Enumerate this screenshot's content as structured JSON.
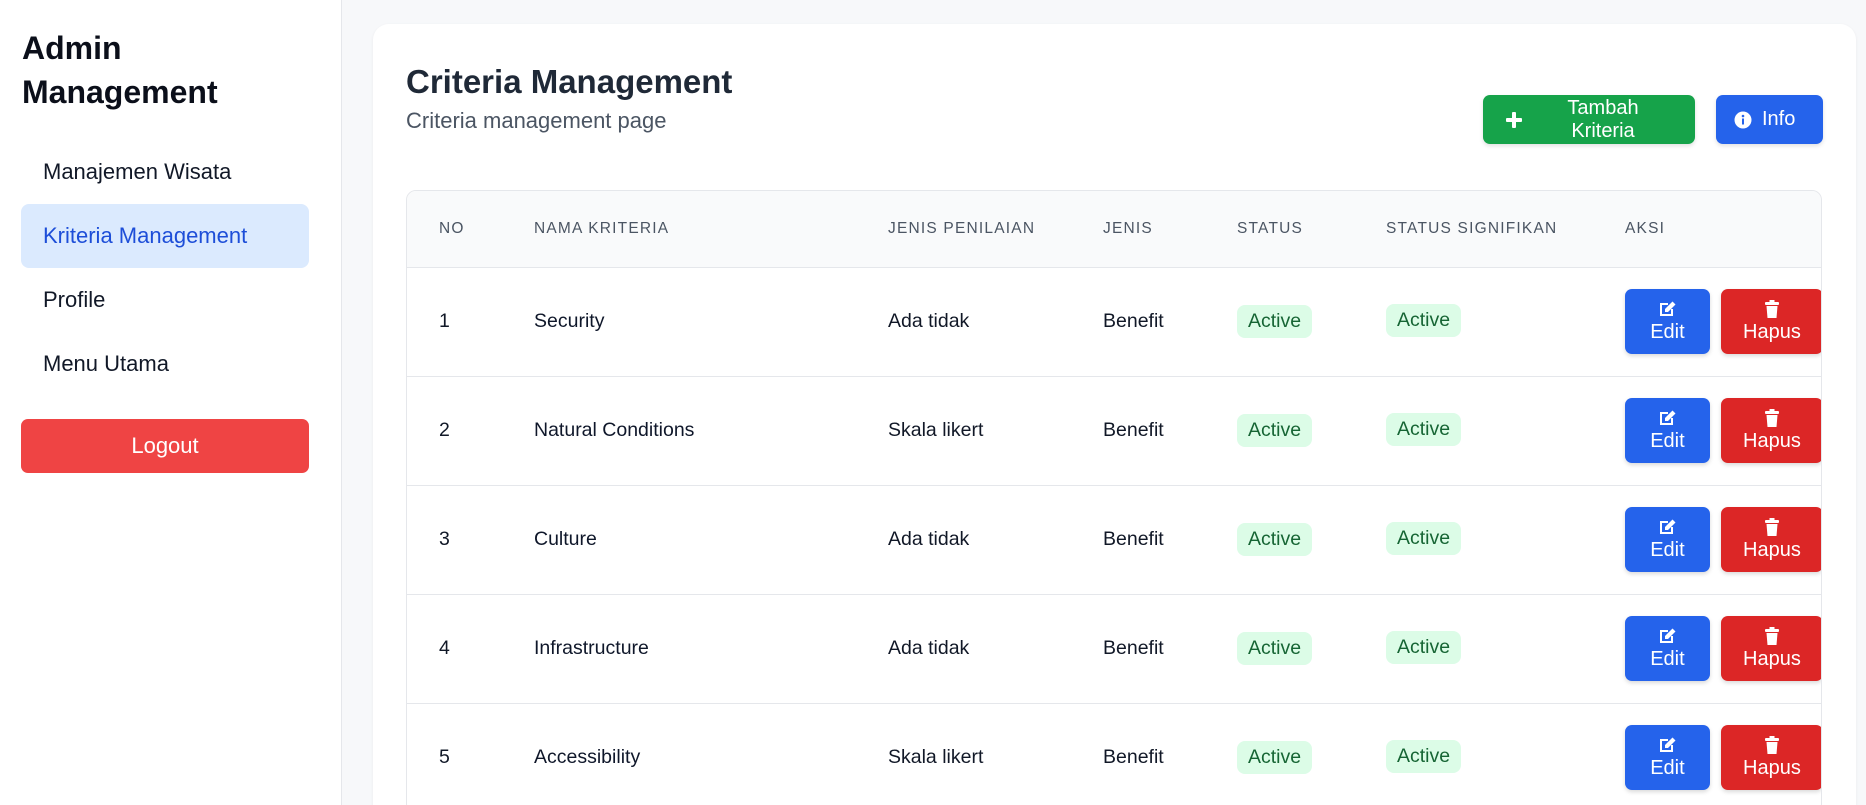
{
  "sidebar": {
    "title_line1": "Admin",
    "title_line2": "Management",
    "items": [
      {
        "label": "Manajemen Wisata"
      },
      {
        "label": "Kriteria Management"
      },
      {
        "label": "Profile"
      },
      {
        "label": "Menu Utama"
      }
    ],
    "active_item": "Kriteria Management",
    "logout_label": "Logout"
  },
  "header": {
    "title": "Criteria Management",
    "subtitle": "Criteria management page",
    "add_label": "Tambah Kriteria",
    "info_label": "Info"
  },
  "table": {
    "columns": [
      "NO",
      "NAMA KRITERIA",
      "JENIS PENILAIAN",
      "JENIS",
      "STATUS",
      "STATUS SIGNIFIKAN",
      "AKSI"
    ],
    "rows": [
      {
        "no": "1",
        "name": "Security",
        "penilaian": "Ada tidak",
        "jenis": "Benefit",
        "status": "Active",
        "signifikan": "Active"
      },
      {
        "no": "2",
        "name": "Natural Conditions",
        "penilaian": "Skala likert",
        "jenis": "Benefit",
        "status": "Active",
        "signifikan": "Active"
      },
      {
        "no": "3",
        "name": "Culture",
        "penilaian": "Ada tidak",
        "jenis": "Benefit",
        "status": "Active",
        "signifikan": "Active"
      },
      {
        "no": "4",
        "name": "Infrastructure",
        "penilaian": "Ada tidak",
        "jenis": "Benefit",
        "status": "Active",
        "signifikan": "Active"
      },
      {
        "no": "5",
        "name": "Accessibility",
        "penilaian": "Skala likert",
        "jenis": "Benefit",
        "status": "Active",
        "signifikan": "Active"
      }
    ],
    "edit_label": "Edit",
    "delete_label": "Hapus"
  },
  "icons": {
    "add": "plus-icon",
    "info": "info-circle-icon",
    "edit": "edit-icon",
    "delete": "trash-icon"
  },
  "colors": {
    "primary": "#2563eb",
    "success": "#16a34a",
    "danger": "#dc2626",
    "logout": "#ef4444",
    "active_nav_bg": "#dbeafe",
    "badge_bg": "#dcfce7",
    "badge_text": "#166534"
  }
}
